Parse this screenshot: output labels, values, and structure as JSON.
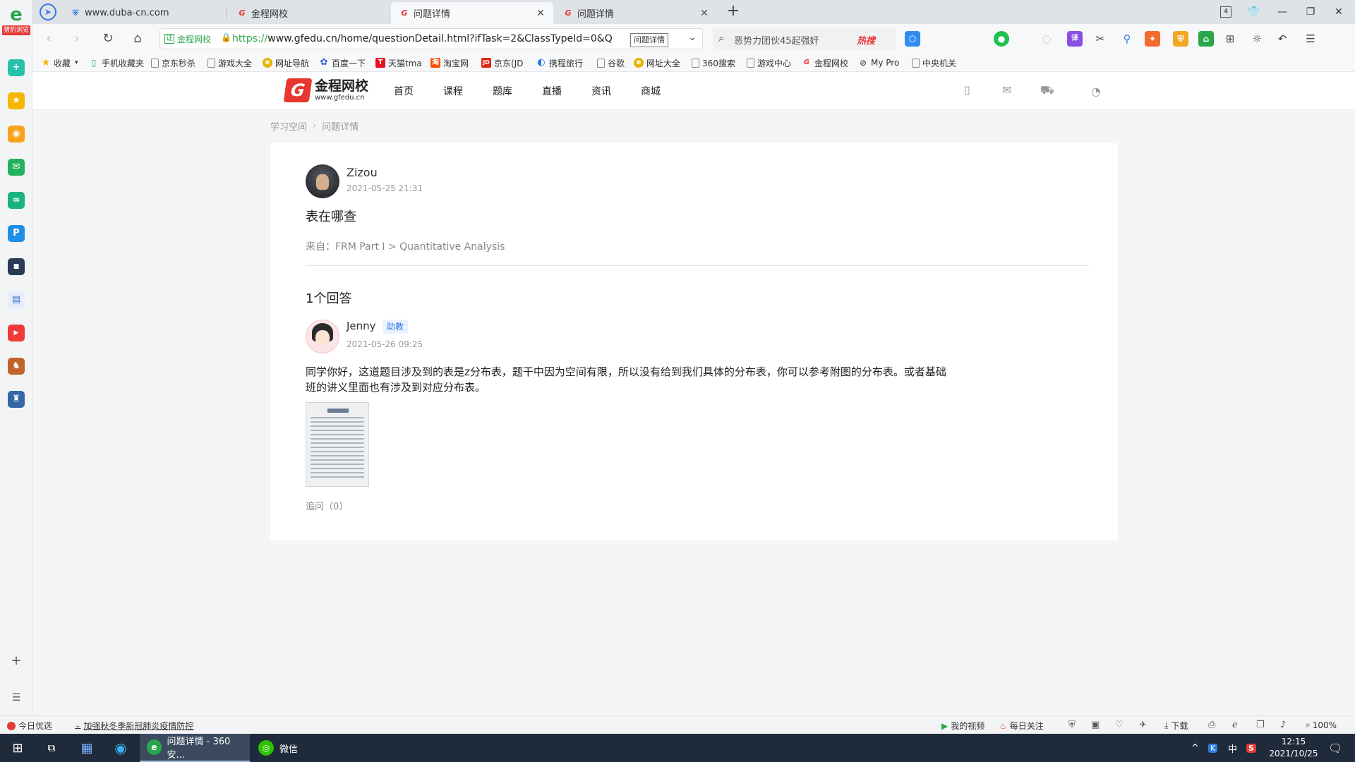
{
  "browser": {
    "left_logo_tag": "猎豹浏览",
    "tabs": [
      {
        "title": "www.duba-cn.com",
        "favicon": "shield-icon"
      },
      {
        "title": "金程网校",
        "favicon": "gfedu-favicon"
      },
      {
        "title": "问题详情",
        "favicon": "gfedu-favicon",
        "active": true
      },
      {
        "title": "问题详情",
        "favicon": "gfedu-favicon"
      }
    ],
    "tab_count": "4",
    "address": {
      "site_label": "金程网校",
      "url_proto": "https://",
      "url_host": "www.gfedu.cn",
      "url_path": "/home/questionDetail.html?ifTask=2&ClassTypeId=0&QuesId",
      "tooltip": "问题详情"
    },
    "search": {
      "query": "恶势力团伙45起强奸",
      "hot_label": "热搜"
    },
    "bookmarks": [
      {
        "label": "收藏",
        "icon": "star-icon"
      },
      {
        "label": "手机收藏夹",
        "icon": "phone-icon"
      },
      {
        "label": "京东秒杀",
        "icon": "doc-icon"
      },
      {
        "label": "游戏大全",
        "icon": "doc-icon"
      },
      {
        "label": "网址导航",
        "icon": "nav-icon"
      },
      {
        "label": "百度一下",
        "icon": "baidu-icon"
      },
      {
        "label": "天猫tma",
        "icon": "tmall-icon"
      },
      {
        "label": "淘宝网",
        "icon": "taobao-icon"
      },
      {
        "label": "京东(JD",
        "icon": "jd-icon"
      },
      {
        "label": "携程旅行",
        "icon": "ctrip-icon"
      },
      {
        "label": "谷歌",
        "icon": "doc-icon"
      },
      {
        "label": "网址大全",
        "icon": "nav-icon"
      },
      {
        "label": "360搜索",
        "icon": "doc-icon"
      },
      {
        "label": "游戏中心",
        "icon": "doc-icon"
      },
      {
        "label": "金程网校",
        "icon": "gfedu-favicon"
      },
      {
        "label": "My Pro",
        "icon": "link-icon"
      },
      {
        "label": "中央机关",
        "icon": "doc-icon"
      }
    ],
    "status_left": [
      {
        "label": "今日优选"
      },
      {
        "label": "加强秋冬季新冠肺炎疫情防控"
      }
    ],
    "status_right": [
      {
        "label": "我的视频"
      },
      {
        "label": "每日关注"
      },
      {
        "label": "下载"
      },
      {
        "label": "100%"
      }
    ]
  },
  "site": {
    "logo_cn": "金程网校",
    "logo_en": "www.gfedu.cn",
    "nav": [
      "首页",
      "课程",
      "题库",
      "直播",
      "资讯",
      "商城"
    ],
    "breadcrumb": [
      "学习空间",
      "问题详情"
    ]
  },
  "question": {
    "user": "Zizou",
    "time": "2021-05-25 21:31",
    "title": "表在哪查",
    "source": "来自：FRM Part I > Quantitative Analysis"
  },
  "answers": {
    "count_label": "1个回答",
    "items": [
      {
        "user": "Jenny",
        "role": "助教",
        "time": "2021-05-26 09:25",
        "body_line1": "同学你好，这道题目涉及到的表是z分布表，题干中因为空间有限，所以没有给到我们具体的分布表，你可以参考附图的分布表。或者基础",
        "body_line2": "班的讲义里面也有涉及到对应分布表。",
        "followup": "追问（0）"
      }
    ]
  },
  "taskbar": {
    "apps": [
      {
        "label": "问题详情 - 360安..."
      },
      {
        "label": "微信"
      }
    ],
    "ime": "中",
    "clock_time": "12:15",
    "clock_date": "2021/10/25"
  },
  "colors": {
    "brand": "#e8372f",
    "link": "#2f7be5",
    "accent_green": "#2aa64a"
  }
}
